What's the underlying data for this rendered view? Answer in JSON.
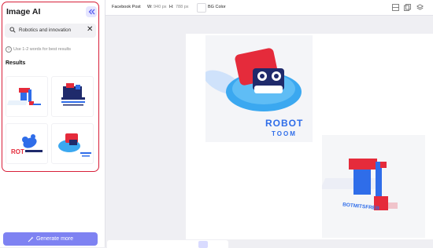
{
  "panel": {
    "title": "Image AI",
    "search_value": "Robotics and innovation",
    "hint": "Use 1-2 words for best results",
    "results_label": "Results",
    "generate_label": "Generate more"
  },
  "toolbar": {
    "format": "Facebook Post",
    "width_label": "W:",
    "width_value": "940 px",
    "height_label": "H:",
    "height_value": "788 px",
    "bg_label": "BG Color",
    "bg_color": "#ffffff"
  },
  "images": {
    "robot_top_text": "ROBOT",
    "robot_bottom_text": "TOOM",
    "arm_caption": "BOTMITSFREB"
  },
  "colors": {
    "accent": "#7e82f2",
    "highlight": "#d8203a",
    "robot_red": "#e52b3b",
    "robot_blue": "#2f6de9",
    "light_blue": "#3ba8f0"
  }
}
